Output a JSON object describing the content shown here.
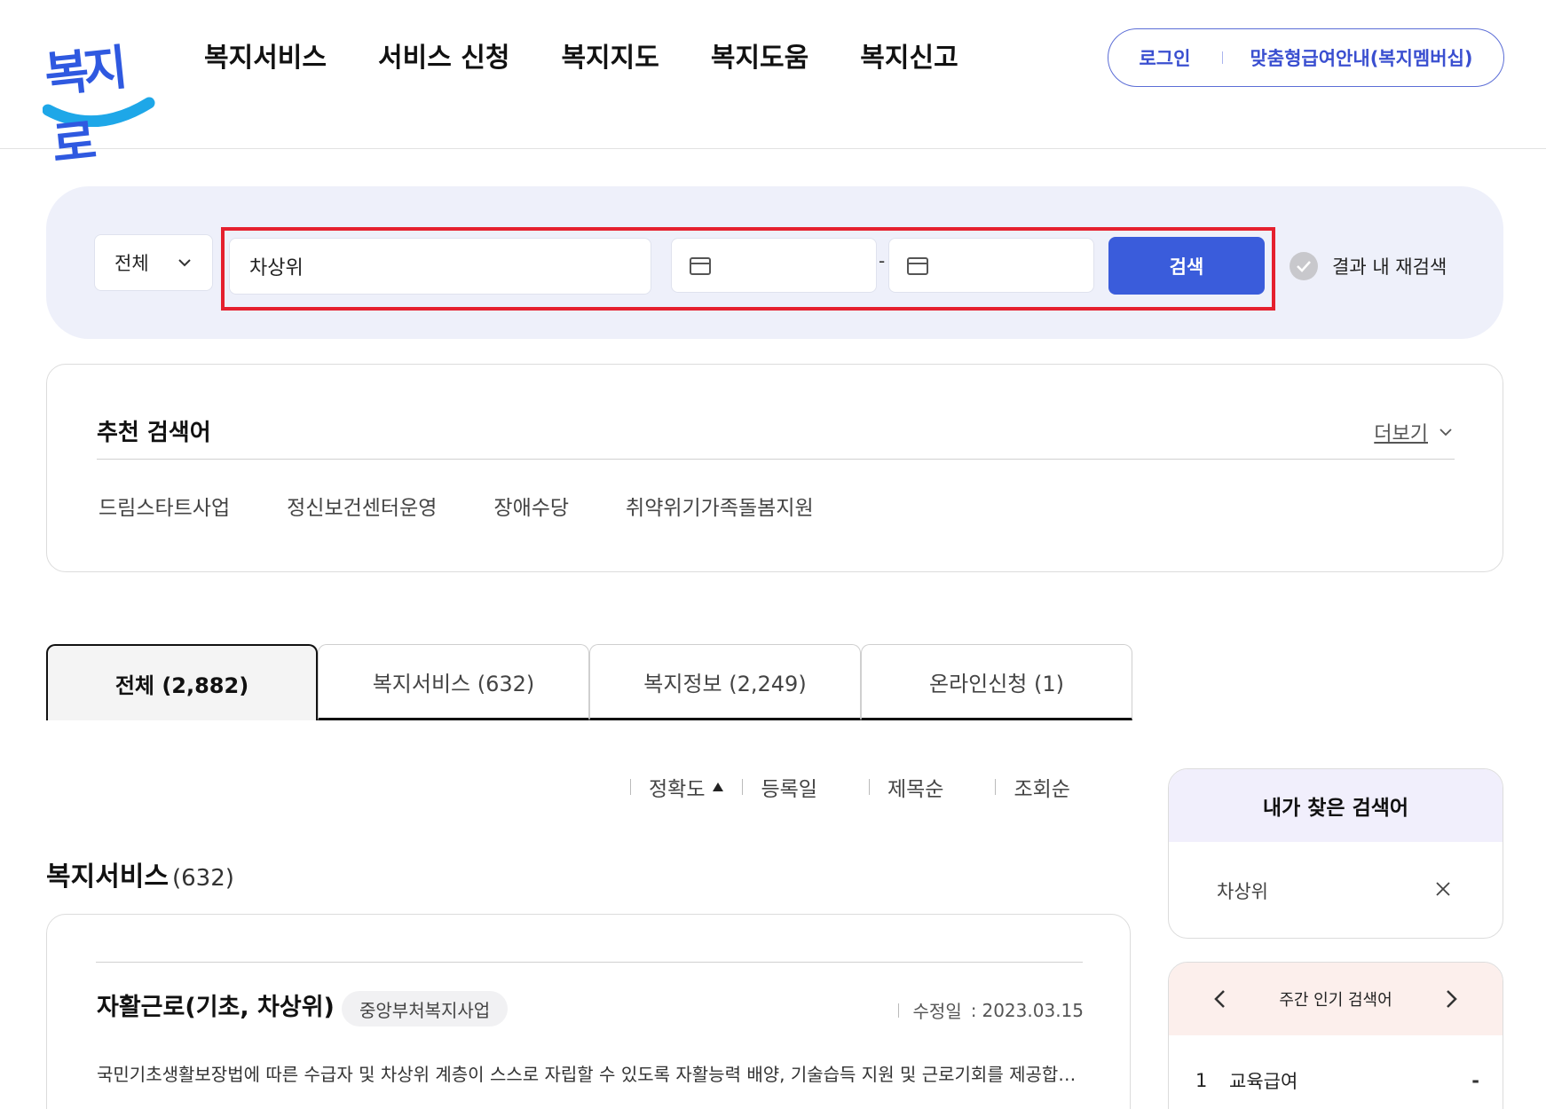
{
  "header": {
    "logo_text": "복지로",
    "nav": [
      "복지서비스",
      "서비스 신청",
      "복지지도",
      "복지도움",
      "복지신고"
    ],
    "login": "로그인",
    "membership": "맞춤형급여안내(복지멤버십)"
  },
  "search": {
    "category": "전체",
    "keyword": "차상위",
    "date_from": "",
    "date_to": "",
    "date_separator": "-",
    "button": "검색",
    "re_search_label": "결과 내 재검색"
  },
  "recommended": {
    "title": "추천 검색어",
    "more": "더보기",
    "keywords": [
      "드림스타트사업",
      "정신보건센터운영",
      "장애수당",
      "취약위기가족돌봄지원"
    ]
  },
  "tabs": [
    {
      "label": "전체 (2,882)",
      "active": true
    },
    {
      "label": "복지서비스 (632)",
      "active": false
    },
    {
      "label": "복지정보 (2,249)",
      "active": false
    },
    {
      "label": "온라인신청 (1)",
      "active": false
    }
  ],
  "sort": [
    "정확도",
    "등록일",
    "제목순",
    "조회순"
  ],
  "section": {
    "title": "복지서비스",
    "count": "(632)"
  },
  "results": [
    {
      "title": "자활근로(기초, 차상위)",
      "badge": "중앙부처복지사업",
      "date_label": "수정일",
      "date": "2023.03.15",
      "description": "국민기초생활보장법에 따른 수급자 및 차상위 계층이 스스로 자립할 수 있도록 자활능력 배양, 기술습득 지원 및 근로기회를 제공합니다"
    }
  ],
  "my_keywords": {
    "title": "내가 찾은 검색어",
    "items": [
      "차상위"
    ]
  },
  "weekly_popular": {
    "title": "주간 인기 검색어",
    "items": [
      {
        "rank": "1",
        "keyword": "교육급여",
        "change": "-"
      }
    ]
  },
  "colors": {
    "primary": "#3a5cdb",
    "highlight": "#e5202e",
    "search_bg": "#eef0fa"
  }
}
